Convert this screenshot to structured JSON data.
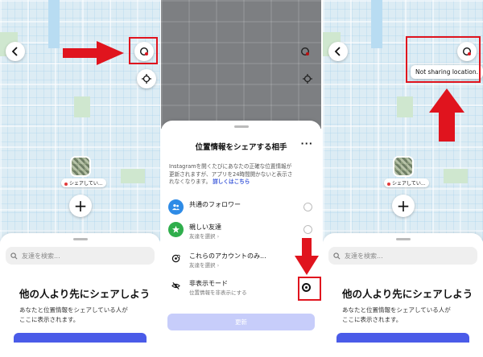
{
  "colors": {
    "accent": "#4a5be8",
    "annotation_red": "#e0141e",
    "map_water": "#dcecf4"
  },
  "map": {
    "pin_label": "シェアしてい..."
  },
  "left_sheet": {
    "search_placeholder": "友達を検索...",
    "title": "他の人より先にシェアしよう",
    "subtitle_line1": "あなたと位置情報をシェアしている人が",
    "subtitle_line2": "ここに表示されます。"
  },
  "mid_sheet": {
    "title": "位置情報をシェアする相手",
    "more_icon": "more-horizontal-icon",
    "desc_line1": "Instagramを開くたびにあなたの正確な位置情報が",
    "desc_line2": "更新されますが、アプリを24時間開かないと表示さ",
    "desc_line3": "れなくなります。",
    "desc_link": "詳しくはこちら",
    "options": [
      {
        "title": "共通のフォロワー",
        "subtitle": "",
        "icon": "people-icon",
        "color": "#2e8be6",
        "selected": false
      },
      {
        "title": "親しい友達",
        "subtitle": "友達を選択",
        "icon": "star-icon",
        "color": "#2fae4c",
        "selected": false
      },
      {
        "title": "これらのアカウントのみ...",
        "subtitle": "友達を選択",
        "icon": "location-check-icon",
        "color": "#ffffff",
        "selected": false
      },
      {
        "title": "非表示モード",
        "subtitle": "位置情報を非表示にする",
        "icon": "eye-off-icon",
        "color": "#ffffff",
        "selected": true
      }
    ],
    "update_button": "更新"
  },
  "right_tooltip": "Not sharing location.",
  "icons": {
    "back": "back-arrow-icon",
    "location_share": "location-share-icon",
    "recenter": "recenter-icon",
    "plus": "plus-icon",
    "search": "search-icon",
    "arrow_right": "red-arrow-right-icon",
    "arrow_down": "red-arrow-down-icon",
    "arrow_up": "red-arrow-up-icon"
  }
}
